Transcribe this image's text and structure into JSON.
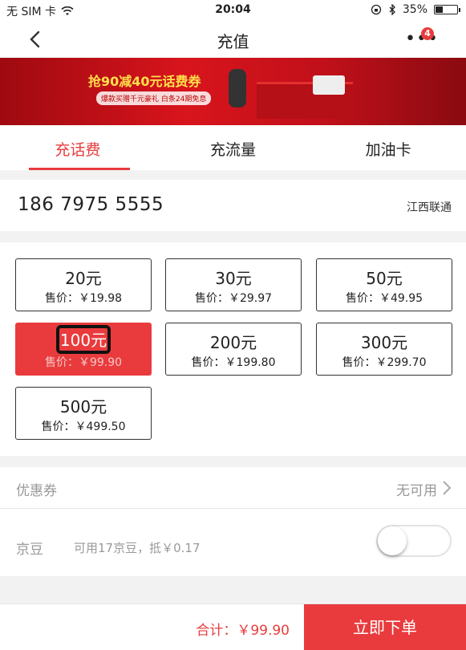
{
  "status_bar": {
    "carrier": "无 SIM 卡",
    "time": "20:04",
    "battery_percent": "35%",
    "battery_level": 0.35
  },
  "nav": {
    "title": "充值",
    "more_badge": "4"
  },
  "banner": {
    "headline": "抢90减40元话费券",
    "subtext": "爆款买赠千元豪礼  白条24期免息"
  },
  "tabs": [
    {
      "label": "充话费",
      "active": true
    },
    {
      "label": "充流量",
      "active": false
    },
    {
      "label": "加油卡",
      "active": false
    }
  ],
  "phone": {
    "number": "186 7975 5555",
    "carrier": "江西联通"
  },
  "amounts": [
    {
      "face": "20元",
      "price": "售价：￥19.98",
      "selected": false
    },
    {
      "face": "30元",
      "price": "售价：￥29.97",
      "selected": false
    },
    {
      "face": "50元",
      "price": "售价：￥49.95",
      "selected": false
    },
    {
      "face": "100元",
      "price": "售价：￥99.90",
      "selected": true
    },
    {
      "face": "200元",
      "price": "售价：￥199.80",
      "selected": false
    },
    {
      "face": "300元",
      "price": "售价：￥299.70",
      "selected": false
    },
    {
      "face": "500元",
      "price": "售价：￥499.50",
      "selected": false
    }
  ],
  "coupon": {
    "label": "优惠券",
    "value": "无可用"
  },
  "beans": {
    "label": "京豆",
    "available": "可用17京豆，抵￥0.17",
    "enabled": false
  },
  "checkout": {
    "total": "合计：￥99.90",
    "order_button": "立即下单"
  },
  "colors": {
    "accent": "#e93b3d"
  }
}
